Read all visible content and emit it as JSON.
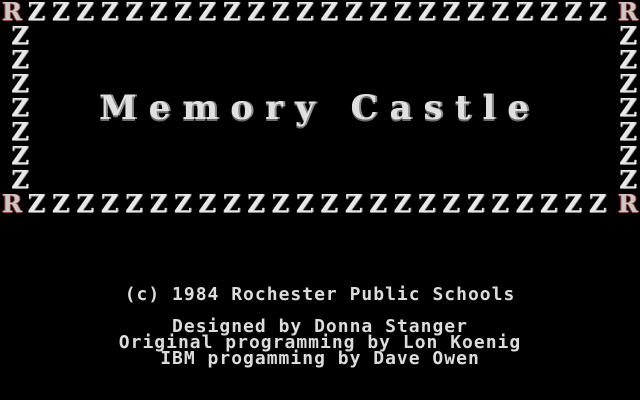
{
  "title": "Memory Castle",
  "frame": {
    "glyph": "Z",
    "corner_glyph": "R"
  },
  "credits": {
    "copyright": "(c) 1984 Rochester Public Schools",
    "designed": "Designed by Donna Stanger",
    "original": "Original programming by Lon Koenig",
    "ibm": "IBM progamming by Dave Owen"
  },
  "colors": {
    "background": "#000000",
    "text": "#dcdcdc",
    "corner_accent": "#b23a3a"
  }
}
